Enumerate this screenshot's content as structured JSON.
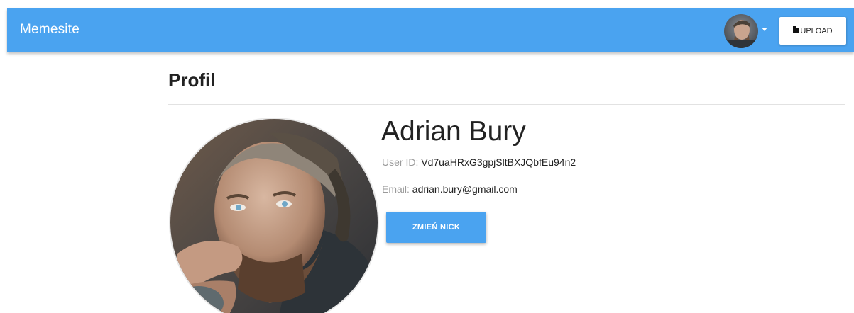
{
  "navbar": {
    "brand": "Memesite",
    "avatar_icon": "user-avatar",
    "caret_icon": "caret-down-icon",
    "upload_icon": "folder-icon",
    "upload_label": "UPLOAD"
  },
  "page": {
    "title": "Profil"
  },
  "profile": {
    "name": "Adrian Bury",
    "user_id_label": "User ID:",
    "user_id": "Vd7uaHRxG3gpjSltBXJQbfEu94n2",
    "email_label": "Email:",
    "email": "adrian.bury@gmail.com",
    "change_nick_label": "ZMIEŃ NICK"
  },
  "colors": {
    "primary": "#4aa3f0",
    "text": "#222222",
    "muted": "#9a9a9a",
    "divider": "#e2e2e2"
  }
}
